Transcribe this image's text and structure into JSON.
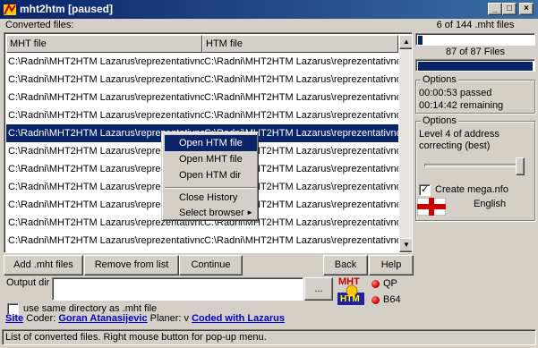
{
  "window": {
    "title": "mht2htm [paused]",
    "controls": {
      "minimize": "_",
      "maximize": "□",
      "close": "×"
    }
  },
  "list": {
    "caption": "Converted files:",
    "headers": {
      "mht": "MHT file",
      "htm": "HTM file"
    },
    "rows": [
      {
        "mht": "C:\\Radni\\MHT2HTM Lazarus\\reprezentativno'",
        "htm": "C:\\Radni\\MHT2HTM Lazarus\\reprezentativno'"
      },
      {
        "mht": "C:\\Radni\\MHT2HTM Lazarus\\reprezentativno'",
        "htm": "C:\\Radni\\MHT2HTM Lazarus\\reprezentativno'"
      },
      {
        "mht": "C:\\Radni\\MHT2HTM Lazarus\\reprezentativno'",
        "htm": "C:\\Radni\\MHT2HTM Lazarus\\reprezentativno'"
      },
      {
        "mht": "C:\\Radni\\MHT2HTM Lazarus\\reprezentativno'",
        "htm": "C:\\Radni\\MHT2HTM Lazarus\\reprezentativno'"
      },
      {
        "mht": "C:\\Radni\\MHT2HTM Lazarus\\reprezentativno'",
        "htm": "C:\\Radni\\MHT2HTM Lazarus\\reprezentativno'",
        "selected": true
      },
      {
        "mht": "C:\\Radni\\MHT2HTM Lazarus\\reprezentativno'",
        "htm": "C:\\Radni\\MHT2HTM Lazarus\\reprezentativno'"
      },
      {
        "mht": "C:\\Radni\\MHT2HTM Lazarus\\reprezentativno'",
        "htm": "C:\\Radni\\MHT2HTM Lazarus\\reprezentativno'"
      },
      {
        "mht": "C:\\Radni\\MHT2HTM Lazarus\\reprezentativno'",
        "htm": "C:\\Radni\\MHT2HTM Lazarus\\reprezentativno'"
      },
      {
        "mht": "C:\\Radni\\MHT2HTM Lazarus\\reprezentativno'",
        "htm": "C:\\Radni\\MHT2HTM Lazarus\\reprezentativno'"
      },
      {
        "mht": "C:\\Radni\\MHT2HTM Lazarus\\reprezentativno'",
        "htm": "C:\\Radni\\MHT2HTM Lazarus\\reprezentativno'"
      },
      {
        "mht": "C:\\Radni\\MHT2HTM Lazarus\\reprezentativno'",
        "htm": "C:\\Radni\\MHT2HTM Lazarus\\reprezentativno'"
      }
    ]
  },
  "context_menu": {
    "items": [
      "Open HTM file",
      "Open MHT file",
      "Open HTM dir"
    ],
    "items2": [
      "Close History",
      "Select browser"
    ],
    "submenu_arrow": "►"
  },
  "right_panel": {
    "files_progress_label": "6 of 144 .mht files",
    "files_progress_fraction": 0.04,
    "total_progress_label": "87 of 87 Files",
    "total_progress_fraction": 1.0,
    "options1_title": "Options",
    "time_passed": "00:00:53 passed",
    "time_remaining": "00:14:42 remaining",
    "options2_title": "Options",
    "level_text": "Level 4 of address correcting (best)",
    "slider_fraction": 1.0,
    "create_mega_label": "Create mega.nfo",
    "create_mega_checked": true,
    "language": "English",
    "flag": "england-flag"
  },
  "buttons": {
    "add": "Add .mht files",
    "remove": "Remove from list",
    "continue": "Continue",
    "back": "Back",
    "help": "Help"
  },
  "output": {
    "label": "Output dir",
    "value": "",
    "browse": "...",
    "same_dir_label": "use same directory as .mht file",
    "same_dir_checked": false
  },
  "logo": {
    "line1": "MHT",
    "line2": "HTM"
  },
  "indicators": {
    "qp": "QP",
    "b64": "B64"
  },
  "credits": {
    "site": "Site",
    "coder_prefix": " Coder: ",
    "coder": "Goran Atanasijevic",
    "planer": " Planer: v ",
    "coded": "Coded with Lazarus"
  },
  "status": "List of converted files. Right mouse button for pop-up menu.",
  "colors": {
    "accent": "#0a246a",
    "link": "#0000cc",
    "indicator": "#d00000"
  }
}
